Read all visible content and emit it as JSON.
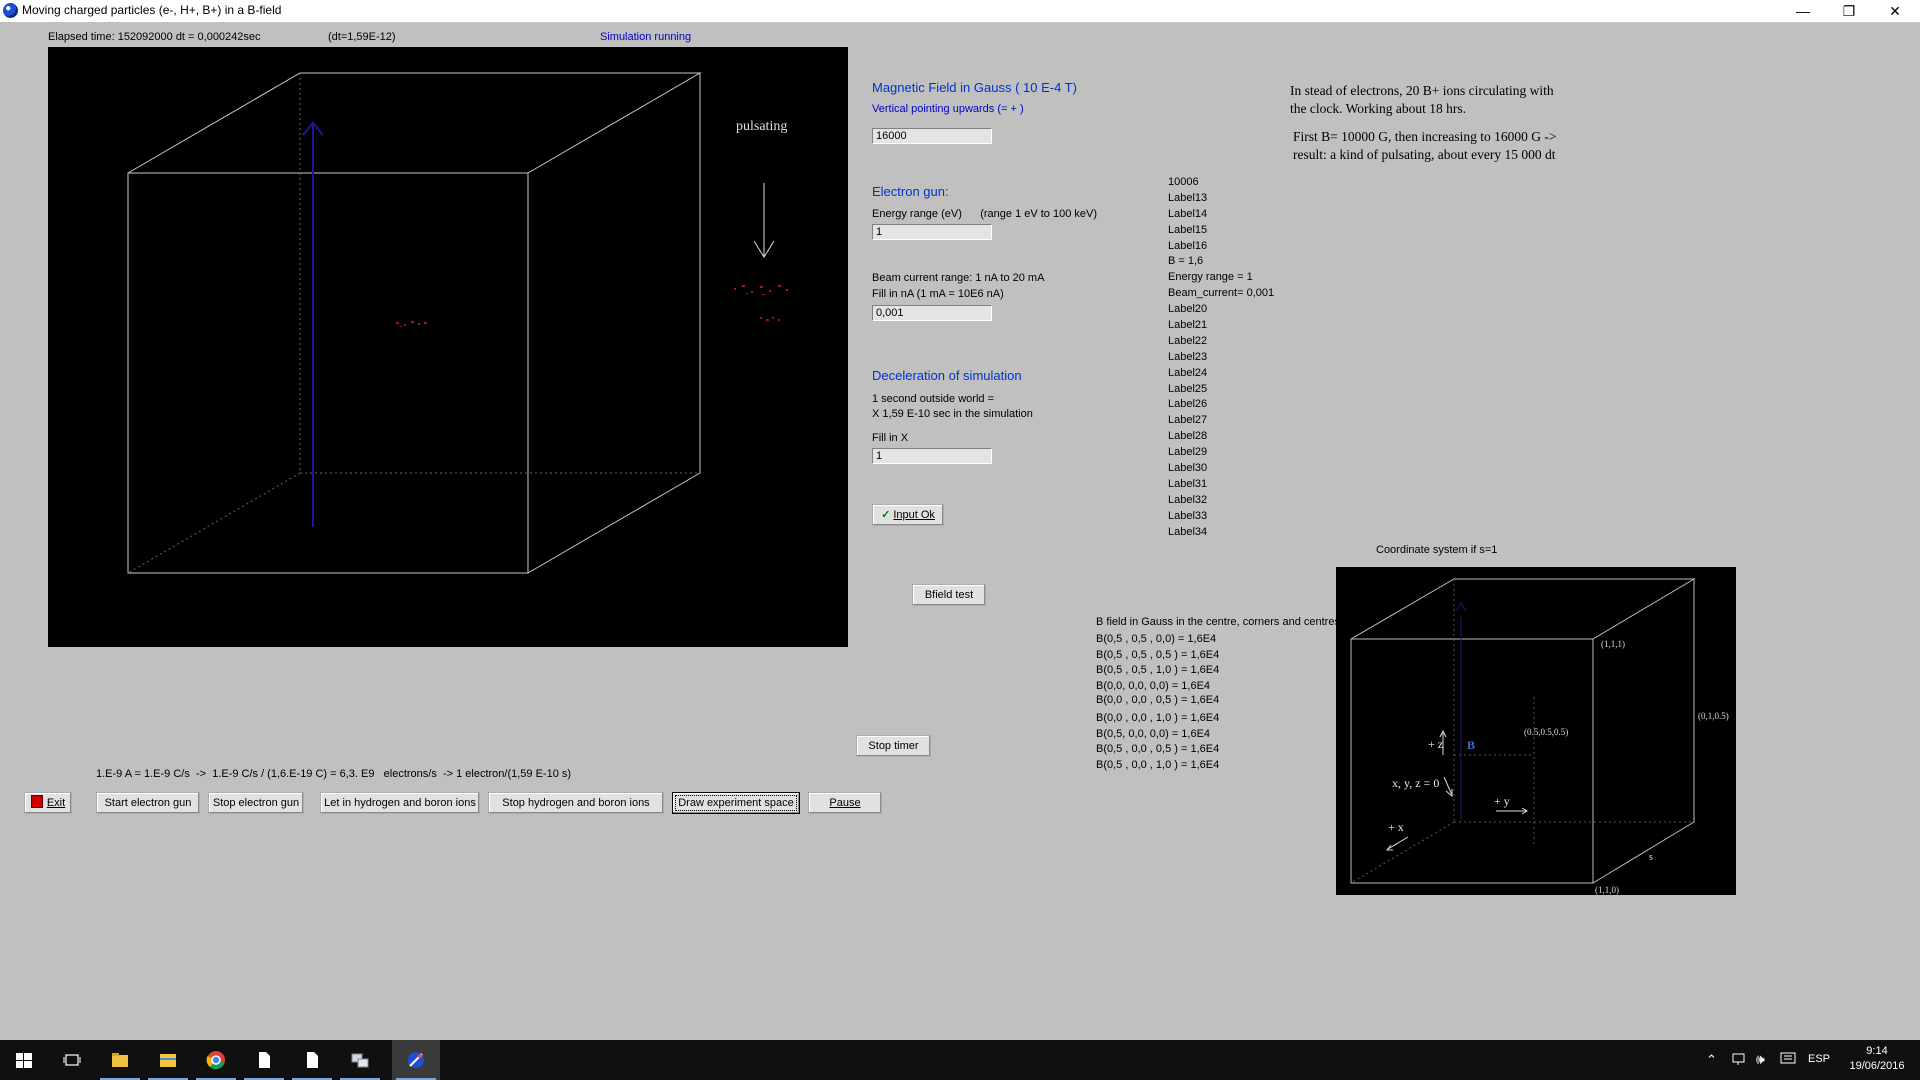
{
  "window": {
    "title": "Moving charged particles (e-, H+, B+) in a B-field",
    "minimize": "—",
    "maximize": "❐",
    "close": "✕"
  },
  "status": {
    "elapsed": "Elapsed time: 152092000 dt    = 0,000242sec",
    "dt": "(dt=1,59E-12)",
    "running": "Simulation running"
  },
  "sim_canvas": {
    "pulsating_label": "pulsating"
  },
  "magnetic": {
    "heading": "Magnetic Field in Gauss ( 10 E-4 T)",
    "subheading": "Vertical pointing upwards (= + )",
    "value": "16000"
  },
  "gun": {
    "heading": "Electron gun:",
    "energy_label": "Energy range (eV)      (range 1 eV to 100 keV)",
    "energy_value": "1",
    "beam_label1": "Beam current range: 1 nA to 20 mA",
    "beam_label2": "Fill in nA (1 mA = 10E6 nA)",
    "beam_value": "0,001"
  },
  "decel": {
    "heading": "Deceleration of simulation",
    "line1": "1 second outside world  =",
    "line2": "X  1,59 E-10 sec in the simulation",
    "fill_label": "Fill in X",
    "value": "1"
  },
  "input_ok": {
    "check": "✓",
    "label": "Input Ok"
  },
  "bfield_test": "Bfield test",
  "stop_timer": "Stop timer",
  "label_column": [
    "10006",
    "Label13",
    "Label14",
    "Label15",
    "Label16",
    "B = 1,6",
    "Energy range = 1",
    "Beam_current= 0,001",
    "Label20",
    "Label21",
    "Label22",
    "Label23",
    "Label24",
    "Label25",
    "Label26",
    "Label27",
    "Label28",
    "Label29",
    "Label30",
    "Label31",
    "Label32",
    "Label33",
    "Label34"
  ],
  "notes": {
    "line1": "In stead of electrons, 20 B+ ions circulating with",
    "line2": "the clock. Working about 18 hrs.",
    "line3": "First B= 10000 G, then increasing to 16000 G ->",
    "line4": "result: a kind of pulsating, about every 15 000 dt"
  },
  "coord": {
    "caption": "Coordinate system if s=1",
    "p111": "(1,1,1)",
    "p_center": "(0.5,0.5,0.5)",
    "p_side": "(0,1,0.5)",
    "p110": "(1,1,0)",
    "plus_z": "+ z",
    "b_label": "B",
    "xyz0": "x, y, z = 0",
    "plus_y": "+ y",
    "plus_x": "+ x",
    "s_label": "s"
  },
  "bfield_list": {
    "header": "B field in Gauss in the centre, corners and centres o",
    "rows": [
      "B(0,5 , 0,5 , 0,0) = 1,6E4",
      "B(0,5 , 0,5 , 0,5 ) = 1,6E4",
      "B(0,5 , 0,5 , 1,0 ) = 1,6E4",
      "B(0,0, 0,0, 0,0) = 1,6E4",
      "B(0,0 , 0,0 , 0,5 ) = 1,6E4",
      "B(0,0 , 0,0 , 1,0 ) = 1,6E4",
      "B(0,5, 0,0, 0,0) = 1,6E4",
      "B(0,5 , 0,0 , 0,5 ) = 1,6E4",
      "B(0,5 , 0,0 , 1,0 ) = 1,6E4"
    ]
  },
  "formula": "1.E-9 A = 1.E-9 C/s  ->  1.E-9 C/s / (1,6.E-19 C) = 6,3. E9   electrons/s  -> 1 electron/(1,59 E-10 s)",
  "buttons": {
    "exit": "Exit",
    "start_gun": "Start electron gun",
    "stop_gun": "Stop electron gun",
    "let_in": "Let in hydrogen and boron ions",
    "stop_ions": "Stop hydrogen and boron ions",
    "draw": "Draw experiment space",
    "pause": "Pause"
  },
  "taskbar": {
    "time": "9:14",
    "date": "19/06/2016",
    "lang": "ESP"
  }
}
